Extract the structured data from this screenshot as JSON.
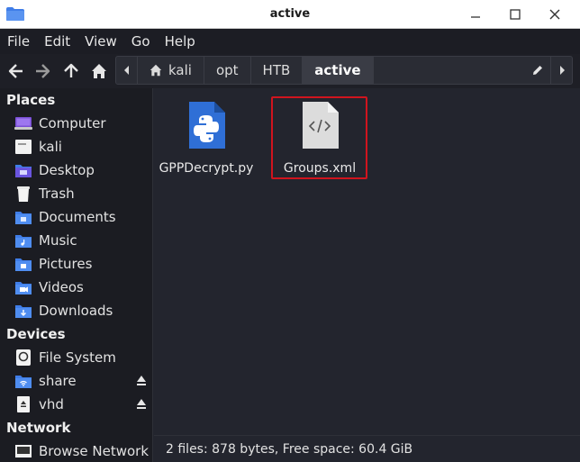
{
  "window": {
    "title": "active"
  },
  "menu": [
    "File",
    "Edit",
    "View",
    "Go",
    "Help"
  ],
  "path": [
    "kali",
    "opt",
    "HTB",
    "active"
  ],
  "sidebar": {
    "places_title": "Places",
    "places": [
      {
        "label": "Computer",
        "icon": "computer-icon"
      },
      {
        "label": "kali",
        "icon": "home-folder-icon"
      },
      {
        "label": "Desktop",
        "icon": "desktop-folder-icon"
      },
      {
        "label": "Trash",
        "icon": "trash-icon"
      },
      {
        "label": "Documents",
        "icon": "documents-folder-icon"
      },
      {
        "label": "Music",
        "icon": "music-folder-icon"
      },
      {
        "label": "Pictures",
        "icon": "pictures-folder-icon"
      },
      {
        "label": "Videos",
        "icon": "videos-folder-icon"
      },
      {
        "label": "Downloads",
        "icon": "downloads-folder-icon"
      }
    ],
    "devices_title": "Devices",
    "devices": [
      {
        "label": "File System",
        "icon": "drive-icon"
      },
      {
        "label": "share",
        "icon": "network-share-icon"
      },
      {
        "label": "vhd",
        "icon": "removable-drive-icon"
      }
    ],
    "network_title": "Network",
    "network": [
      {
        "label": "Browse Network",
        "icon": "network-icon"
      }
    ]
  },
  "files": [
    {
      "name": "GPPDecrypt.py",
      "icon": "python-file-icon"
    },
    {
      "name": "Groups.xml",
      "icon": "xml-file-icon",
      "selected": true
    }
  ],
  "status": "2 files: 878 bytes, Free space: 60.4 GiB",
  "colors": {
    "accent_folder": "#3f7de8",
    "selection_border": "#d0141e",
    "python_icon": "#2f6fd6"
  }
}
